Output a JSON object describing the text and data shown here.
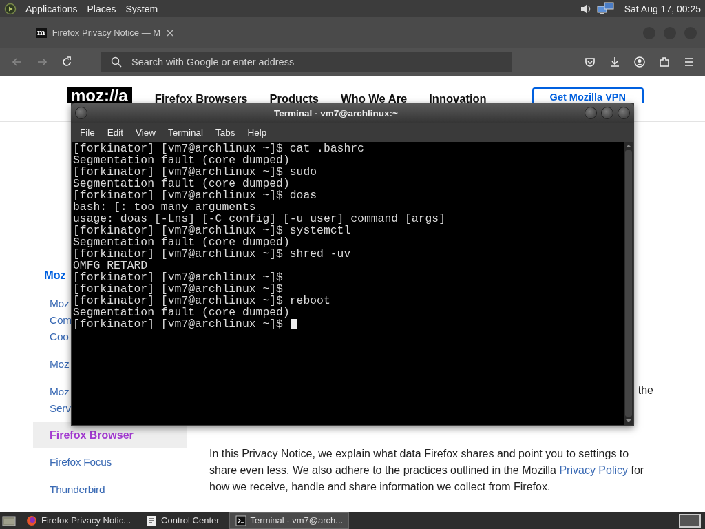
{
  "top_panel": {
    "menus": [
      "Applications",
      "Places",
      "System"
    ],
    "clock": "Sat Aug 17, 00:25"
  },
  "browser": {
    "tab": {
      "favicon": "m",
      "title": "Firefox Privacy Notice — M"
    },
    "address_placeholder": "Search with Google or enter address"
  },
  "page": {
    "logo": "moz://a",
    "nav": [
      "Firefox Browsers",
      "Products",
      "Who We Are",
      "Innovation"
    ],
    "cta": "Get Mozilla VPN",
    "sidebar": {
      "heading": "Moz",
      "items": [
        {
          "lines": [
            "Moz",
            "Com",
            "Coo"
          ],
          "selected": false
        },
        {
          "lines": [
            "Moz"
          ],
          "selected": false
        },
        {
          "lines": [
            "Moz",
            "Serv"
          ],
          "selected": false
        },
        {
          "lines": [
            "Firefox Browser"
          ],
          "selected": true
        },
        {
          "lines": [
            "Firefox Focus"
          ],
          "selected": false
        },
        {
          "lines": [
            "Thunderbird"
          ],
          "selected": false
        }
      ]
    },
    "fragment": "the",
    "paragraph": {
      "before": "In this Privacy Notice, we explain what data Firefox shares and point you to settings to share even less. We also adhere to the practices outlined in the Mozilla",
      "link": "Privacy Policy",
      "after": "for how we receive, handle and share information we collect from Firefox."
    }
  },
  "terminal": {
    "title": "Terminal - vm7@archlinux:~",
    "menu": [
      "File",
      "Edit",
      "View",
      "Terminal",
      "Tabs",
      "Help"
    ],
    "lines": [
      "[forkinator] [vm7@archlinux ~]$ cat .bashrc",
      "Segmentation fault (core dumped)",
      "[forkinator] [vm7@archlinux ~]$ sudo",
      "Segmentation fault (core dumped)",
      "[forkinator] [vm7@archlinux ~]$ doas",
      "bash: [: too many arguments",
      "usage: doas [-Lns] [-C config] [-u user] command [args]",
      "[forkinator] [vm7@archlinux ~]$ systemctl",
      "Segmentation fault (core dumped)",
      "[forkinator] [vm7@archlinux ~]$ shred -uv",
      "OMFG RETARD",
      "[forkinator] [vm7@archlinux ~]$",
      "[forkinator] [vm7@archlinux ~]$",
      "[forkinator] [vm7@archlinux ~]$ reboot",
      "Segmentation fault (core dumped)",
      "[forkinator] [vm7@archlinux ~]$ "
    ]
  },
  "taskbar": {
    "items": [
      {
        "kind": "firefox",
        "label": "Firefox Privacy Notic...",
        "selected": false
      },
      {
        "kind": "control",
        "label": "Control Center",
        "selected": false
      },
      {
        "kind": "terminal",
        "label": "Terminal - vm7@arch...",
        "selected": true
      }
    ]
  }
}
